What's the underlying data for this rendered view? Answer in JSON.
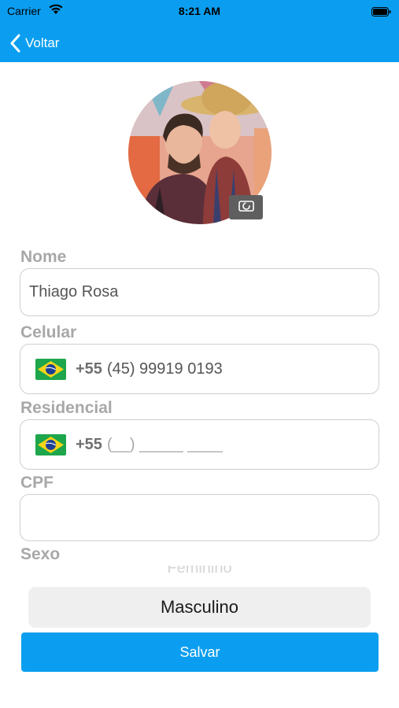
{
  "status_bar": {
    "carrier": "Carrier",
    "time": "8:21 AM"
  },
  "nav": {
    "back_label": "Voltar",
    "color": "#0b9ef0"
  },
  "profile": {
    "photo_icon": "camera-icon"
  },
  "form": {
    "nome": {
      "label": "Nome",
      "value": "Thiago Rosa"
    },
    "celular": {
      "label": "Celular",
      "country_code": "+55",
      "value": "(45) 99919 0193",
      "flag_icon": "brazil-flag-icon"
    },
    "residencial": {
      "label": "Residencial",
      "country_code": "+55",
      "placeholder": "(__) _____ ____",
      "flag_icon": "brazil-flag-icon"
    },
    "cpf": {
      "label": "CPF",
      "value": ""
    },
    "sexo": {
      "label": "Sexo",
      "option_above": "Feminino",
      "selected": "Masculino"
    }
  },
  "actions": {
    "save_label": "Salvar"
  }
}
